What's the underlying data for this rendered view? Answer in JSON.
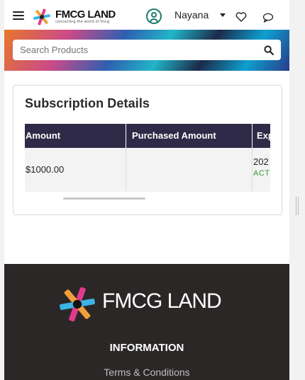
{
  "header": {
    "brand": "FMCG LAND",
    "tagline": "connecting the world of fmcg",
    "user_name": "Nayana",
    "icons": [
      "menu-icon",
      "user-icon",
      "heart-icon",
      "chat-icon"
    ]
  },
  "search": {
    "placeholder": "Search Products"
  },
  "subscription": {
    "title": "Subscription Details",
    "columns": [
      "Amount",
      "Purchased Amount",
      "Exp..."
    ],
    "rows": [
      {
        "amount": "$1000.00",
        "purchased_amount": "",
        "expiry": "202",
        "status": "ACTI"
      }
    ]
  },
  "footer": {
    "brand": "FMCG LAND",
    "heading": "INFORMATION",
    "link": "Terms & Conditions"
  },
  "colors": {
    "table_header": "#2f2a47",
    "status_active": "#2e9a3c",
    "footer_bg": "#2b2727",
    "user_icon": "#1b7a6e"
  }
}
